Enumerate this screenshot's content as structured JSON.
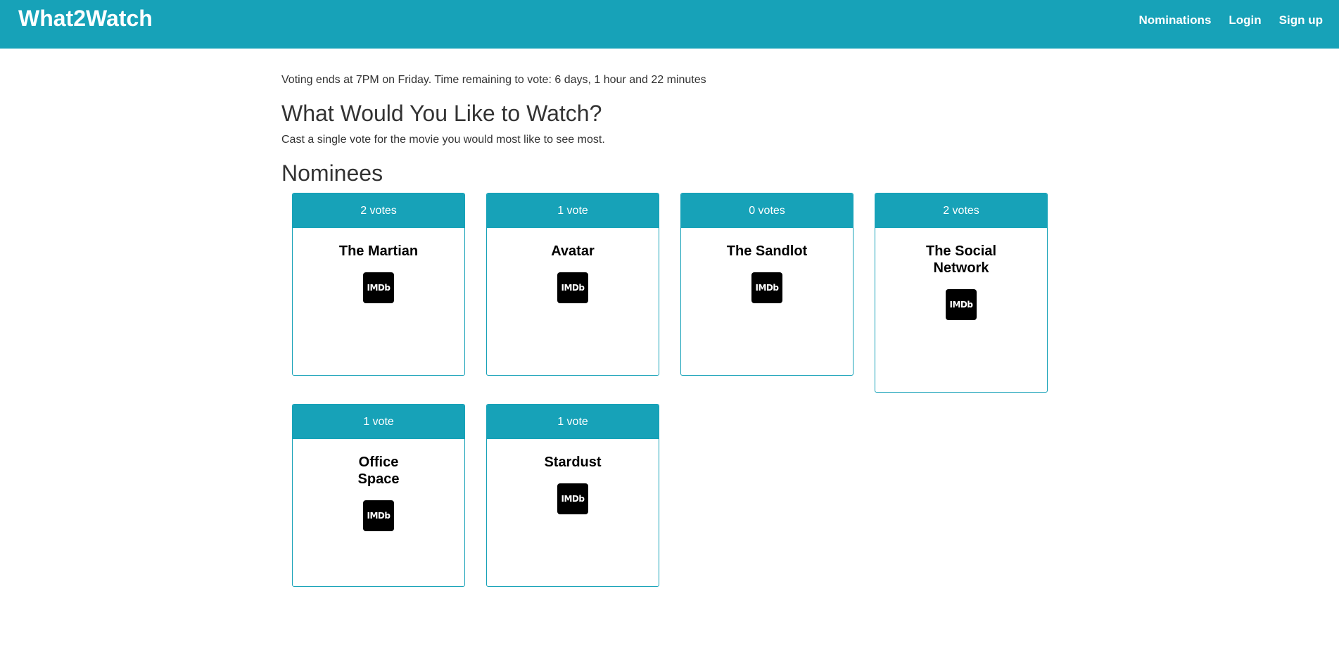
{
  "navbar": {
    "brand": "What2Watch",
    "links": [
      "Nominations",
      "Login",
      "Sign up"
    ]
  },
  "main": {
    "voting_info": "Voting ends at 7PM on Friday. Time remaining to vote: 6 days, 1 hour and 22 minutes",
    "heading": "What Would You Like to Watch?",
    "subtext": "Cast a single vote for the movie you would most like to see most.",
    "nominees_heading": "Nominees"
  },
  "nominees": [
    {
      "votes": "2 votes",
      "title": "The Martian",
      "imdb": "IMDb"
    },
    {
      "votes": "1 vote",
      "title": "Avatar",
      "imdb": "IMDb"
    },
    {
      "votes": "0 votes",
      "title": "The Sandlot",
      "imdb": "IMDb"
    },
    {
      "votes": "2 votes",
      "title": "The Social Network",
      "imdb": "IMDb"
    },
    {
      "votes": "1 vote",
      "title": "Office Space",
      "imdb": "IMDb"
    },
    {
      "votes": "1 vote",
      "title": "Stardust",
      "imdb": "IMDb"
    }
  ],
  "colors": {
    "accent": "#17a2b8",
    "text": "#333333",
    "imdb_badge": "#000000"
  }
}
